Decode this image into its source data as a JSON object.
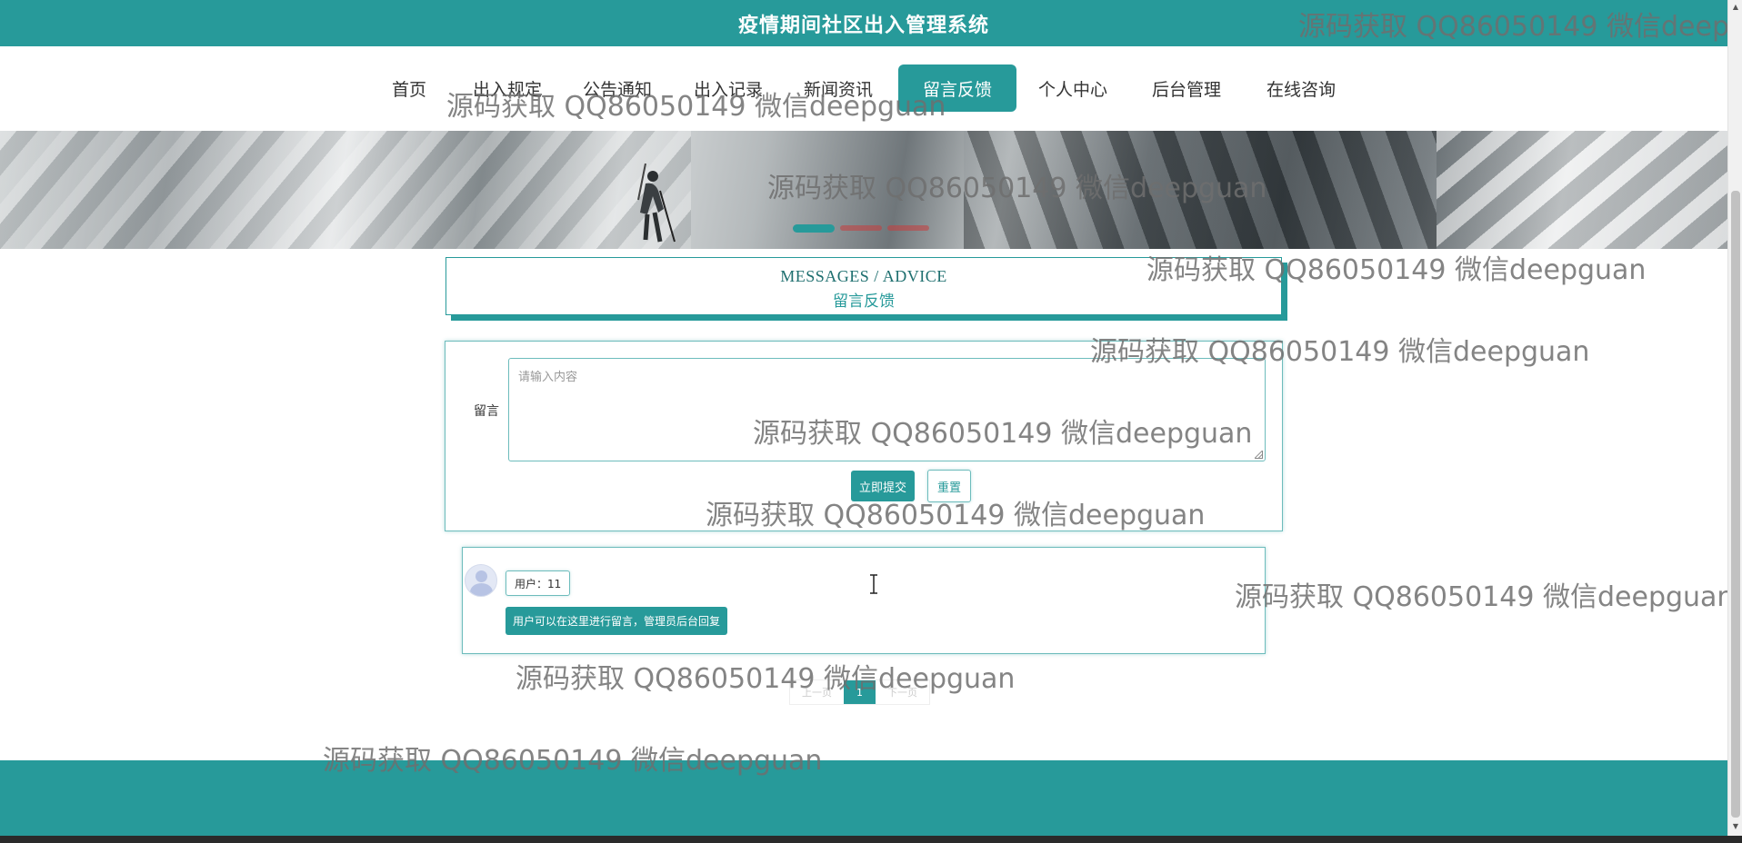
{
  "header": {
    "title": "疫情期间社区出入管理系统"
  },
  "nav": {
    "items": [
      {
        "label": "首页",
        "active": false
      },
      {
        "label": "出入规定",
        "active": false
      },
      {
        "label": "公告通知",
        "active": false
      },
      {
        "label": "出入记录",
        "active": false
      },
      {
        "label": "新闻资讯",
        "active": false
      },
      {
        "label": "留言反馈",
        "active": true
      },
      {
        "label": "个人中心",
        "active": false
      },
      {
        "label": "后台管理",
        "active": false
      },
      {
        "label": "在线咨询",
        "active": false
      }
    ]
  },
  "banner": {
    "slide_count": 3,
    "active_slide": 1
  },
  "section": {
    "title_en": "MESSAGES / ADVICE",
    "title_zh": "留言反馈"
  },
  "form": {
    "label": "留言",
    "placeholder": "请输入内容",
    "submit_label": "立即提交",
    "reset_label": "重置"
  },
  "messages": [
    {
      "user": "用户：11",
      "content": "用户可以在这里进行留言，管理员后台回复"
    }
  ],
  "pagination": {
    "prev_label": "上一页",
    "current_page": "1",
    "next_label": "下一页"
  },
  "watermark": {
    "text": "源码获取 QQ86050149 微信deepguan"
  },
  "colors": {
    "primary": "#279a9a",
    "footer": "#279a9a",
    "border": "#6dbcbc"
  }
}
